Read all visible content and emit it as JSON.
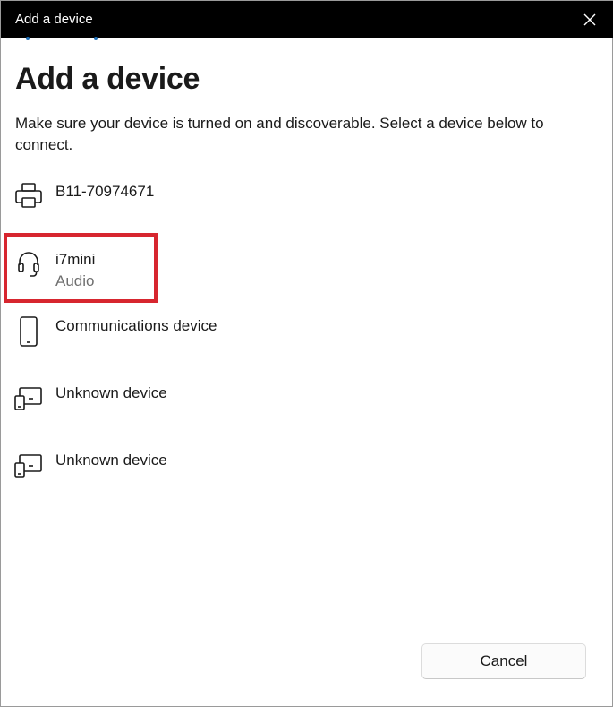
{
  "window": {
    "title": "Add a device"
  },
  "main": {
    "heading": "Add a device",
    "instructions": "Make sure your device is turned on and discoverable. Select a device below to connect."
  },
  "devices": [
    {
      "name": "B11-70974671",
      "subtitle": "",
      "icon": "printer-icon"
    },
    {
      "name": "i7mini",
      "subtitle": "Audio",
      "icon": "headset-icon",
      "highlighted": true
    },
    {
      "name": "Communications device",
      "subtitle": "",
      "icon": "phone-icon"
    },
    {
      "name": "Unknown device",
      "subtitle": "",
      "icon": "devices-icon"
    },
    {
      "name": "Unknown device",
      "subtitle": "",
      "icon": "devices-icon"
    }
  ],
  "footer": {
    "cancel_label": "Cancel"
  },
  "colors": {
    "titlebar": "#000000",
    "highlight": "#d7262f",
    "secondary_text": "#6f6f6f"
  }
}
